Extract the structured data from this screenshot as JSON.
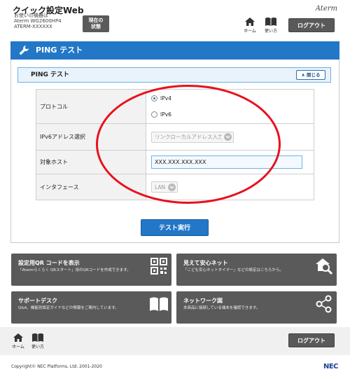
{
  "header": {
    "title": "クイック設定Web",
    "device_lines": [
      "お使いの機器は",
      "Aterm WG2600HP4",
      "ATERM-XXXXXX"
    ],
    "status_button": [
      "現在の",
      "状態"
    ],
    "brand": "Aterm",
    "nav": {
      "home_label": "ホーム",
      "help_label": "使い方"
    },
    "logout_label": "ログアウト"
  },
  "page": {
    "title": "PING テスト",
    "section_title": "PING テスト",
    "collapse_label": "閉じる"
  },
  "form": {
    "protocol_label": "プロトコル",
    "protocol_options": [
      "IPv4",
      "IPv6"
    ],
    "protocol_selected": "IPv4",
    "ipv6_label": "IPv6アドレス選択",
    "ipv6_value": "リンクローカルアドレス入力",
    "target_label": "対象ホスト",
    "target_value": "XXX.XXX.XXX.XXX",
    "interface_label": "インタフェース",
    "interface_value": "LAN"
  },
  "execute_label": "テスト実行",
  "cards": [
    {
      "title": "設定用QR コードを表示",
      "desc": "「Atermらくらく QRスタート」用のQRコードを作成できます。",
      "icon": "qr-code-icon"
    },
    {
      "title": "見えて安心ネット",
      "desc": "「こども安心ネットタイマー」などの設定はこちらから。",
      "icon": "home-search-icon"
    },
    {
      "title": "サポートデスク",
      "desc": "Q&A、機能別設定ガイドなどの情報をご案内しています。",
      "icon": "book-icon"
    },
    {
      "title": "ネットワーク図",
      "desc": "本商品に接続している端末を確認できます。",
      "icon": "network-icon"
    }
  ],
  "footer": {
    "home_label": "ホーム",
    "help_label": "使い方",
    "logout_label": "ログアウト",
    "copyright": "Copyright© NEC Platforms, Ltd. 2001-2020",
    "logo": "NEC"
  },
  "colors": {
    "accent": "#2377c7",
    "dark_button": "#5a5a5a",
    "highlight_ring": "#e8111d"
  }
}
